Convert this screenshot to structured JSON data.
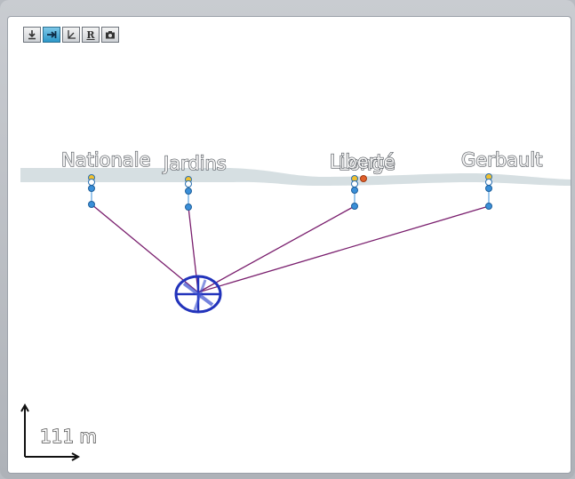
{
  "toolbar": {
    "buttons": [
      {
        "icon": "download-icon",
        "active": false
      },
      {
        "icon": "pan-arrow-icon",
        "active": true
      },
      {
        "icon": "axes-icon",
        "active": false
      },
      {
        "icon": "R",
        "label": "R",
        "active": false
      },
      {
        "icon": "camera-icon",
        "active": false
      }
    ]
  },
  "map": {
    "stations": [
      {
        "name": "Nationale"
      },
      {
        "name": "Jardins"
      },
      {
        "name": "Liberté"
      },
      {
        "name": "Gerbault"
      },
      {
        "name": "Longe"
      }
    ],
    "scale": {
      "label": "111 m"
    }
  },
  "colors": {
    "link_line": "#7a1f6e",
    "ellipse": "#2233bb",
    "node": "#3a8fd8",
    "river": "#d6dfe2",
    "active_node": "#e0602a"
  }
}
